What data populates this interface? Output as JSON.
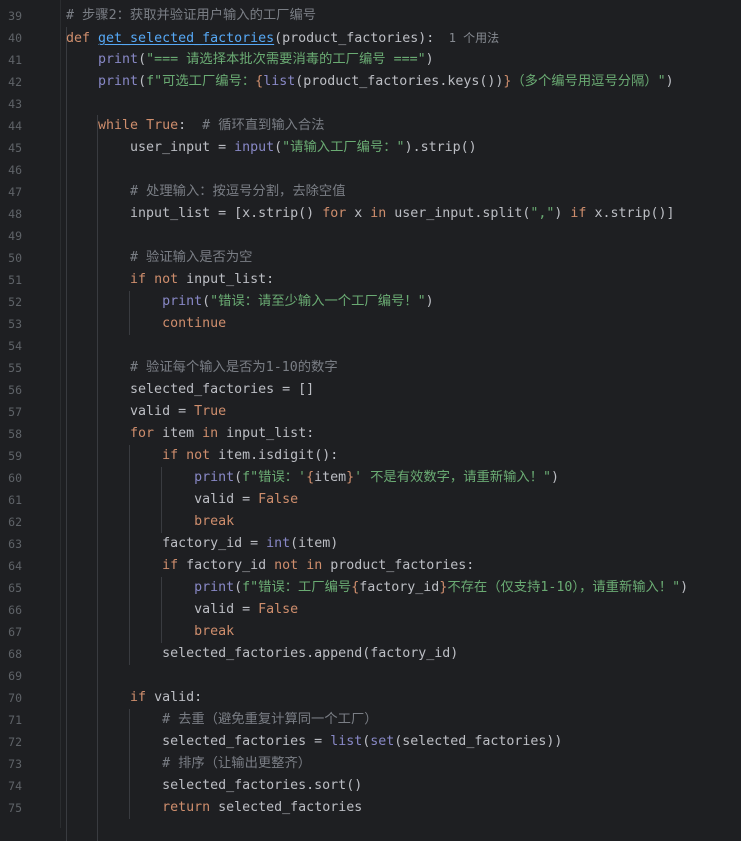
{
  "editor": {
    "lines": [
      {
        "n": "39",
        "tokens": [
          {
            "t": "# 步骤2：获取并验证用户输入的工厂编号",
            "c": "cm"
          }
        ]
      },
      {
        "n": "40",
        "tokens": [
          {
            "t": "def ",
            "c": "kw"
          },
          {
            "t": "get_selected_factories",
            "c": "fn"
          },
          {
            "t": "(product_factories):",
            "c": ""
          },
          {
            "t": "  1 个用法",
            "c": "hint"
          }
        ]
      },
      {
        "n": "41",
        "tokens": [
          {
            "t": "    ",
            "c": ""
          },
          {
            "t": "print",
            "c": "bi"
          },
          {
            "t": "(",
            "c": ""
          },
          {
            "t": "\"=== 请选择本批次需要消毒的工厂编号 ===\"",
            "c": "str"
          },
          {
            "t": ")",
            "c": ""
          }
        ]
      },
      {
        "n": "42",
        "tokens": [
          {
            "t": "    ",
            "c": ""
          },
          {
            "t": "print",
            "c": "bi"
          },
          {
            "t": "(",
            "c": ""
          },
          {
            "t": "f\"可选工厂编号：",
            "c": "str"
          },
          {
            "t": "{",
            "c": "kw"
          },
          {
            "t": "list",
            "c": "bi"
          },
          {
            "t": "(product_factories.keys())",
            "c": ""
          },
          {
            "t": "}",
            "c": "kw"
          },
          {
            "t": "（多个编号用逗号分隔）\"",
            "c": "str"
          },
          {
            "t": ")",
            "c": ""
          }
        ]
      },
      {
        "n": "43",
        "tokens": []
      },
      {
        "n": "44",
        "tokens": [
          {
            "t": "    ",
            "c": ""
          },
          {
            "t": "while ",
            "c": "kw"
          },
          {
            "t": "True",
            "c": "tv"
          },
          {
            "t": ":  ",
            "c": ""
          },
          {
            "t": "# 循环直到输入合法",
            "c": "cm"
          }
        ]
      },
      {
        "n": "45",
        "tokens": [
          {
            "t": "        user_input = ",
            "c": ""
          },
          {
            "t": "input",
            "c": "bi"
          },
          {
            "t": "(",
            "c": ""
          },
          {
            "t": "\"请输入工厂编号：\"",
            "c": "str"
          },
          {
            "t": ").strip()",
            "c": ""
          }
        ]
      },
      {
        "n": "46",
        "tokens": []
      },
      {
        "n": "47",
        "tokens": [
          {
            "t": "        ",
            "c": ""
          },
          {
            "t": "# 处理输入：按逗号分割，去除空值",
            "c": "cm"
          }
        ]
      },
      {
        "n": "48",
        "tokens": [
          {
            "t": "        input_list = [x.strip() ",
            "c": ""
          },
          {
            "t": "for ",
            "c": "kw"
          },
          {
            "t": "x ",
            "c": ""
          },
          {
            "t": "in ",
            "c": "kw"
          },
          {
            "t": "user_input.split(",
            "c": ""
          },
          {
            "t": "\",\"",
            "c": "str"
          },
          {
            "t": ") ",
            "c": ""
          },
          {
            "t": "if ",
            "c": "kw"
          },
          {
            "t": "x.strip()]",
            "c": ""
          }
        ]
      },
      {
        "n": "49",
        "tokens": []
      },
      {
        "n": "50",
        "tokens": [
          {
            "t": "        ",
            "c": ""
          },
          {
            "t": "# 验证输入是否为空",
            "c": "cm"
          }
        ]
      },
      {
        "n": "51",
        "tokens": [
          {
            "t": "        ",
            "c": ""
          },
          {
            "t": "if not ",
            "c": "kw"
          },
          {
            "t": "input_list:",
            "c": ""
          }
        ]
      },
      {
        "n": "52",
        "tokens": [
          {
            "t": "            ",
            "c": ""
          },
          {
            "t": "print",
            "c": "bi"
          },
          {
            "t": "(",
            "c": ""
          },
          {
            "t": "\"错误：请至少输入一个工厂编号！\"",
            "c": "str"
          },
          {
            "t": ")",
            "c": ""
          }
        ]
      },
      {
        "n": "53",
        "tokens": [
          {
            "t": "            ",
            "c": ""
          },
          {
            "t": "continue",
            "c": "kw"
          }
        ]
      },
      {
        "n": "54",
        "tokens": []
      },
      {
        "n": "55",
        "tokens": [
          {
            "t": "        ",
            "c": ""
          },
          {
            "t": "# 验证每个输入是否为1-10的数字",
            "c": "cm"
          }
        ]
      },
      {
        "n": "56",
        "tokens": [
          {
            "t": "        selected_factories = []",
            "c": ""
          }
        ]
      },
      {
        "n": "57",
        "tokens": [
          {
            "t": "        valid = ",
            "c": ""
          },
          {
            "t": "True",
            "c": "tv"
          }
        ]
      },
      {
        "n": "58",
        "tokens": [
          {
            "t": "        ",
            "c": ""
          },
          {
            "t": "for ",
            "c": "kw"
          },
          {
            "t": "item ",
            "c": ""
          },
          {
            "t": "in ",
            "c": "kw"
          },
          {
            "t": "input_list:",
            "c": ""
          }
        ]
      },
      {
        "n": "59",
        "tokens": [
          {
            "t": "            ",
            "c": ""
          },
          {
            "t": "if not ",
            "c": "kw"
          },
          {
            "t": "item.isdigit():",
            "c": ""
          }
        ]
      },
      {
        "n": "60",
        "tokens": [
          {
            "t": "                ",
            "c": ""
          },
          {
            "t": "print",
            "c": "bi"
          },
          {
            "t": "(",
            "c": ""
          },
          {
            "t": "f\"错误：'",
            "c": "str"
          },
          {
            "t": "{",
            "c": "kw"
          },
          {
            "t": "item",
            "c": ""
          },
          {
            "t": "}",
            "c": "kw"
          },
          {
            "t": "' 不是有效数字，请重新输入！\"",
            "c": "str"
          },
          {
            "t": ")",
            "c": ""
          }
        ]
      },
      {
        "n": "61",
        "tokens": [
          {
            "t": "                valid = ",
            "c": ""
          },
          {
            "t": "False",
            "c": "tv"
          }
        ]
      },
      {
        "n": "62",
        "tokens": [
          {
            "t": "                ",
            "c": ""
          },
          {
            "t": "break",
            "c": "kw"
          }
        ]
      },
      {
        "n": "63",
        "tokens": [
          {
            "t": "            factory_id = ",
            "c": ""
          },
          {
            "t": "int",
            "c": "bi"
          },
          {
            "t": "(item)",
            "c": ""
          }
        ]
      },
      {
        "n": "64",
        "tokens": [
          {
            "t": "            ",
            "c": ""
          },
          {
            "t": "if ",
            "c": "kw"
          },
          {
            "t": "factory_id ",
            "c": ""
          },
          {
            "t": "not in ",
            "c": "kw"
          },
          {
            "t": "product_factories:",
            "c": ""
          }
        ]
      },
      {
        "n": "65",
        "tokens": [
          {
            "t": "                ",
            "c": ""
          },
          {
            "t": "print",
            "c": "bi"
          },
          {
            "t": "(",
            "c": ""
          },
          {
            "t": "f\"错误：工厂编号",
            "c": "str"
          },
          {
            "t": "{",
            "c": "kw"
          },
          {
            "t": "factory_id",
            "c": ""
          },
          {
            "t": "}",
            "c": "kw"
          },
          {
            "t": "不存在（仅支持1-10），请重新输入！\"",
            "c": "str"
          },
          {
            "t": ")",
            "c": ""
          }
        ]
      },
      {
        "n": "66",
        "tokens": [
          {
            "t": "                valid = ",
            "c": ""
          },
          {
            "t": "False",
            "c": "tv"
          }
        ]
      },
      {
        "n": "67",
        "tokens": [
          {
            "t": "                ",
            "c": ""
          },
          {
            "t": "break",
            "c": "kw"
          }
        ]
      },
      {
        "n": "68",
        "tokens": [
          {
            "t": "            selected_factories.append(factory_id)",
            "c": ""
          }
        ]
      },
      {
        "n": "69",
        "tokens": []
      },
      {
        "n": "70",
        "tokens": [
          {
            "t": "        ",
            "c": ""
          },
          {
            "t": "if ",
            "c": "kw"
          },
          {
            "t": "valid:",
            "c": ""
          }
        ]
      },
      {
        "n": "71",
        "tokens": [
          {
            "t": "            ",
            "c": ""
          },
          {
            "t": "# 去重（避免重复计算同一个工厂）",
            "c": "cm"
          }
        ]
      },
      {
        "n": "72",
        "tokens": [
          {
            "t": "            selected_factories = ",
            "c": ""
          },
          {
            "t": "list",
            "c": "bi"
          },
          {
            "t": "(",
            "c": ""
          },
          {
            "t": "set",
            "c": "bi"
          },
          {
            "t": "(selected_factories))",
            "c": ""
          }
        ]
      },
      {
        "n": "73",
        "tokens": [
          {
            "t": "            ",
            "c": ""
          },
          {
            "t": "# 排序（让输出更整齐）",
            "c": "cm"
          }
        ]
      },
      {
        "n": "74",
        "tokens": [
          {
            "t": "            selected_factories.sort()",
            "c": ""
          }
        ]
      },
      {
        "n": "75",
        "tokens": [
          {
            "t": "            ",
            "c": ""
          },
          {
            "t": "return ",
            "c": "kw"
          },
          {
            "t": "selected_factories",
            "c": ""
          }
        ]
      }
    ]
  }
}
